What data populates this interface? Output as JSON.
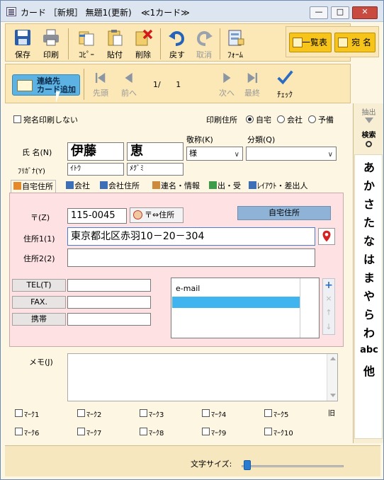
{
  "window": {
    "title": "カード ［新規］ 無題1(更新)",
    "subtitle": "≪1カード≫",
    "min": "—",
    "max": "□",
    "close": "✕"
  },
  "toolbar1": {
    "save": "保存",
    "print": "印刷",
    "copy": "ｺﾋﾟｰ",
    "paste": "貼付",
    "delete": "削除",
    "undo": "戻す",
    "redo": "取消",
    "form": "ﾌｫｰﾑ",
    "list_view": "一覧表",
    "addressee": "宛 名"
  },
  "toolbar2": {
    "add_contact": "連絡先\nカード追加",
    "first": "先頭",
    "prev": "前へ",
    "page_current": "1",
    "page_sep": "/",
    "page_total": "1",
    "next": "次へ",
    "last": "最終",
    "check": "ﾁｪｯｸ"
  },
  "sidebar": {
    "extract": "抽出",
    "search": "検索",
    "kana": [
      "あ",
      "か",
      "さ",
      "た",
      "な",
      "は",
      "ま",
      "や",
      "ら",
      "わ",
      "abc",
      "他"
    ]
  },
  "form": {
    "no_print_label": "宛名印刷しない",
    "print_addr_label": "印刷住所",
    "print_addr_options": [
      "自宅",
      "会社",
      "予備"
    ],
    "print_addr_selected": "自宅",
    "name_label": "氏 名(N)",
    "kana_label": "ﾌﾘｶﾞﾅ(Y)",
    "last_name": "伊藤",
    "first_name": "恵",
    "last_kana": "ｲﾄｳ",
    "first_kana": "ﾒｸﾞﾐ",
    "honorific_label": "敬称(K)",
    "honorific_value": "様",
    "category_label": "分類(Q)",
    "category_value": ""
  },
  "tabs": [
    {
      "label": "自宅住所",
      "active": true,
      "icon": "home-icon"
    },
    {
      "label": "会社",
      "active": false,
      "icon": "building-icon"
    },
    {
      "label": "会社住所",
      "active": false,
      "icon": "office-address-icon"
    },
    {
      "label": "連名・情報",
      "active": false,
      "icon": "people-icon"
    },
    {
      "label": "出・受",
      "active": false,
      "icon": "exchange-icon"
    },
    {
      "label": "ﾚｲｱｳﾄ・差出人",
      "active": false,
      "icon": "layout-icon"
    }
  ],
  "address": {
    "zip_label": "〒(Z)",
    "zip_value": "115-0045",
    "zip_convert": "〒⇔住所",
    "home_badge": "自宅住所",
    "addr1_label": "住所1(1)",
    "addr1_value": "東京都北区赤羽10－20－304",
    "addr2_label": "住所2(2)",
    "addr2_value": "",
    "tel_label": "TEL(T)",
    "fax_label": "FAX.",
    "mobile_label": "携帯",
    "tel_value": "",
    "fax_value": "",
    "mobile_value": "",
    "email_header": "e-mail",
    "email_list": [
      "",
      ""
    ]
  },
  "memo": {
    "label": "メモ(J)",
    "value": "",
    "history_icon": "旧"
  },
  "marks": [
    "ﾏｰｸ1",
    "ﾏｰｸ2",
    "ﾏｰｸ3",
    "ﾏｰｸ4",
    "ﾏｰｸ5",
    "ﾏｰｸ6",
    "ﾏｰｸ7",
    "ﾏｰｸ8",
    "ﾏｰｸ9",
    "ﾏｰｸ10"
  ],
  "status": {
    "font_size_label": "文字サイズ:"
  }
}
